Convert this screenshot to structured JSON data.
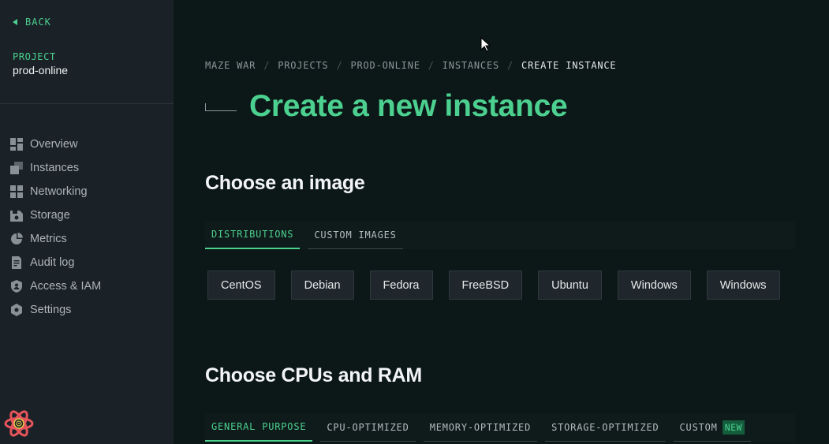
{
  "sidebar": {
    "back_label": "BACK",
    "project_label": "PROJECT",
    "project_name": "prod-online",
    "nav": [
      {
        "label": "Overview",
        "icon": "dashboard-icon"
      },
      {
        "label": "Instances",
        "icon": "instances-icon"
      },
      {
        "label": "Networking",
        "icon": "network-icon"
      },
      {
        "label": "Storage",
        "icon": "storage-icon"
      },
      {
        "label": "Metrics",
        "icon": "metrics-icon"
      },
      {
        "label": "Audit log",
        "icon": "document-icon"
      },
      {
        "label": "Access & IAM",
        "icon": "shield-icon"
      },
      {
        "label": "Settings",
        "icon": "gear-icon"
      }
    ]
  },
  "breadcrumb": [
    "MAZE WAR",
    "PROJECTS",
    "PROD-ONLINE",
    "INSTANCES",
    "CREATE INSTANCE"
  ],
  "page_title": "Create a new instance",
  "image_section": {
    "title": "Choose an image",
    "tabs": [
      "DISTRIBUTIONS",
      "CUSTOM IMAGES"
    ],
    "distributions": [
      "CentOS",
      "Debian",
      "Fedora",
      "FreeBSD",
      "Ubuntu",
      "Windows",
      "Windows"
    ]
  },
  "cpu_section": {
    "title": "Choose CPUs and RAM",
    "tabs": [
      "GENERAL PURPOSE",
      "CPU-OPTIMIZED",
      "MEMORY-OPTIMIZED",
      "STORAGE-OPTIMIZED",
      "CUSTOM"
    ],
    "new_badge": "NEW"
  },
  "colors": {
    "accent": "#4cd08f",
    "sidebar_bg": "#1a2227",
    "main_bg": "#0c1717",
    "button_bg": "#1f272c"
  }
}
